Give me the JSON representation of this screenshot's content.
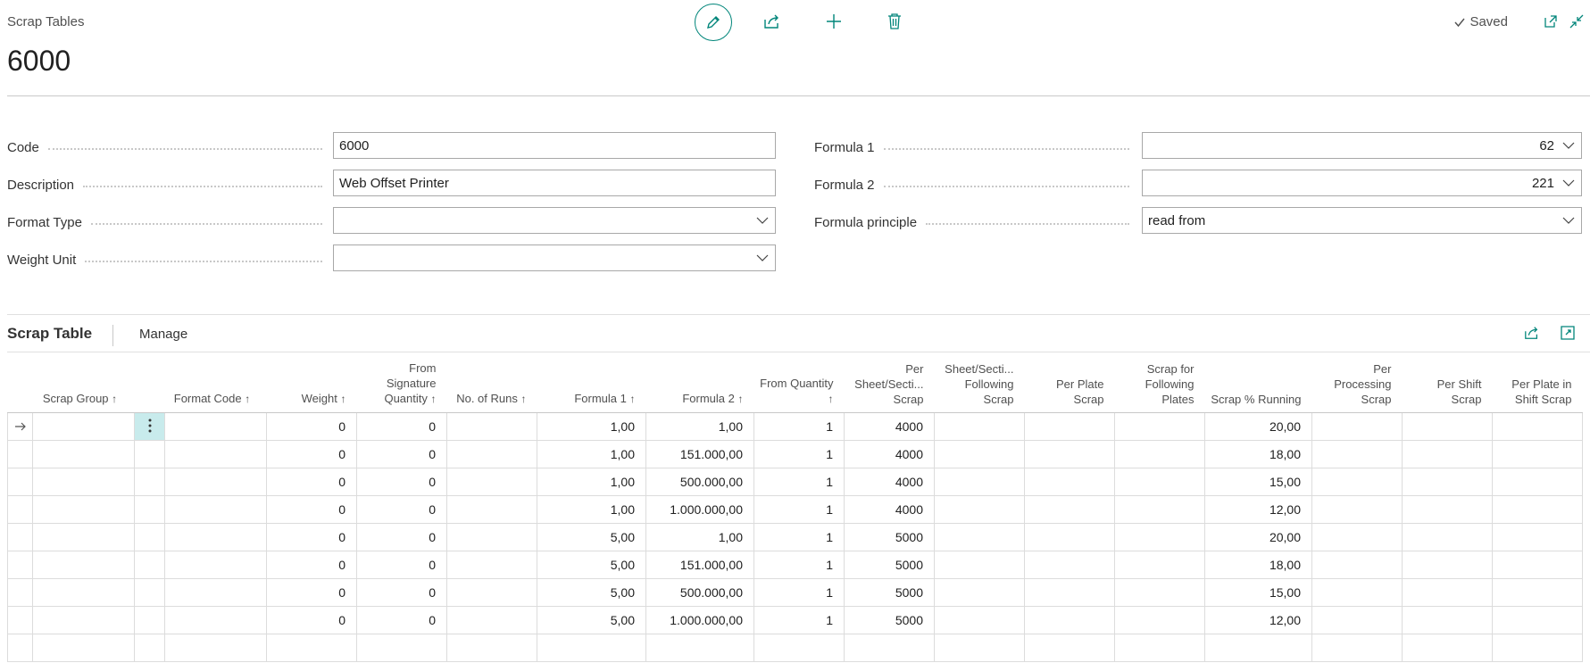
{
  "header": {
    "breadcrumb": "Scrap Tables",
    "title": "6000",
    "saved_label": "Saved"
  },
  "form": {
    "left": [
      {
        "label": "Code",
        "value": "6000",
        "type": "text"
      },
      {
        "label": "Description",
        "value": "Web Offset Printer",
        "type": "text"
      },
      {
        "label": "Format Type",
        "value": "",
        "type": "select"
      },
      {
        "label": "Weight Unit",
        "value": "",
        "type": "select"
      }
    ],
    "right": [
      {
        "label": "Formula 1",
        "value": "62",
        "type": "select-right"
      },
      {
        "label": "Formula 2",
        "value": "221",
        "type": "select-right"
      },
      {
        "label": "Formula principle",
        "value": "read from",
        "type": "select"
      }
    ]
  },
  "subpage": {
    "title": "Scrap Table",
    "manage_label": "Manage"
  },
  "table": {
    "columns": [
      {
        "label": "Scrap Group",
        "arrow": "↑"
      },
      {
        "label": "Format Code",
        "arrow": "↑"
      },
      {
        "label": "Weight",
        "arrow": "↑"
      },
      {
        "label": "From Signature Quantity",
        "arrow": "↑"
      },
      {
        "label": "No. of Runs",
        "arrow": "↑"
      },
      {
        "label": "Formula 1",
        "arrow": "↑"
      },
      {
        "label": "Formula 2",
        "arrow": "↑"
      },
      {
        "label": "From Quantity",
        "arrow": "↑"
      },
      {
        "label": "Per Sheet/Secti... Scrap",
        "arrow": ""
      },
      {
        "label": "Sheet/Secti... Following Scrap",
        "arrow": ""
      },
      {
        "label": "Per Plate Scrap",
        "arrow": ""
      },
      {
        "label": "Scrap for Following Plates",
        "arrow": ""
      },
      {
        "label": "Scrap % Running",
        "arrow": ""
      },
      {
        "label": "Per Processing Scrap",
        "arrow": ""
      },
      {
        "label": "Per Shift Scrap",
        "arrow": ""
      },
      {
        "label": "Per Plate in Shift Scrap",
        "arrow": ""
      }
    ],
    "rows": [
      [
        "",
        "",
        "0",
        "0",
        "",
        "1,00",
        "1,00",
        "1",
        "4000",
        "",
        "",
        "",
        "20,00",
        "",
        "",
        ""
      ],
      [
        "",
        "",
        "0",
        "0",
        "",
        "1,00",
        "151.000,00",
        "1",
        "4000",
        "",
        "",
        "",
        "18,00",
        "",
        "",
        ""
      ],
      [
        "",
        "",
        "0",
        "0",
        "",
        "1,00",
        "500.000,00",
        "1",
        "4000",
        "",
        "",
        "",
        "15,00",
        "",
        "",
        ""
      ],
      [
        "",
        "",
        "0",
        "0",
        "",
        "1,00",
        "1.000.000,00",
        "1",
        "4000",
        "",
        "",
        "",
        "12,00",
        "",
        "",
        ""
      ],
      [
        "",
        "",
        "0",
        "0",
        "",
        "5,00",
        "1,00",
        "1",
        "5000",
        "",
        "",
        "",
        "20,00",
        "",
        "",
        ""
      ],
      [
        "",
        "",
        "0",
        "0",
        "",
        "5,00",
        "151.000,00",
        "1",
        "5000",
        "",
        "",
        "",
        "18,00",
        "",
        "",
        ""
      ],
      [
        "",
        "",
        "0",
        "0",
        "",
        "5,00",
        "500.000,00",
        "1",
        "5000",
        "",
        "",
        "",
        "15,00",
        "",
        "",
        ""
      ],
      [
        "",
        "",
        "0",
        "0",
        "",
        "5,00",
        "1.000.000,00",
        "1",
        "5000",
        "",
        "",
        "",
        "12,00",
        "",
        "",
        ""
      ],
      [
        "",
        "",
        "",
        "",
        "",
        "",
        "",
        "",
        "",
        "",
        "",
        "",
        "",
        "",
        "",
        ""
      ]
    ]
  },
  "colors": {
    "accent": "#00857a",
    "active_cell": "#c8ebec"
  }
}
